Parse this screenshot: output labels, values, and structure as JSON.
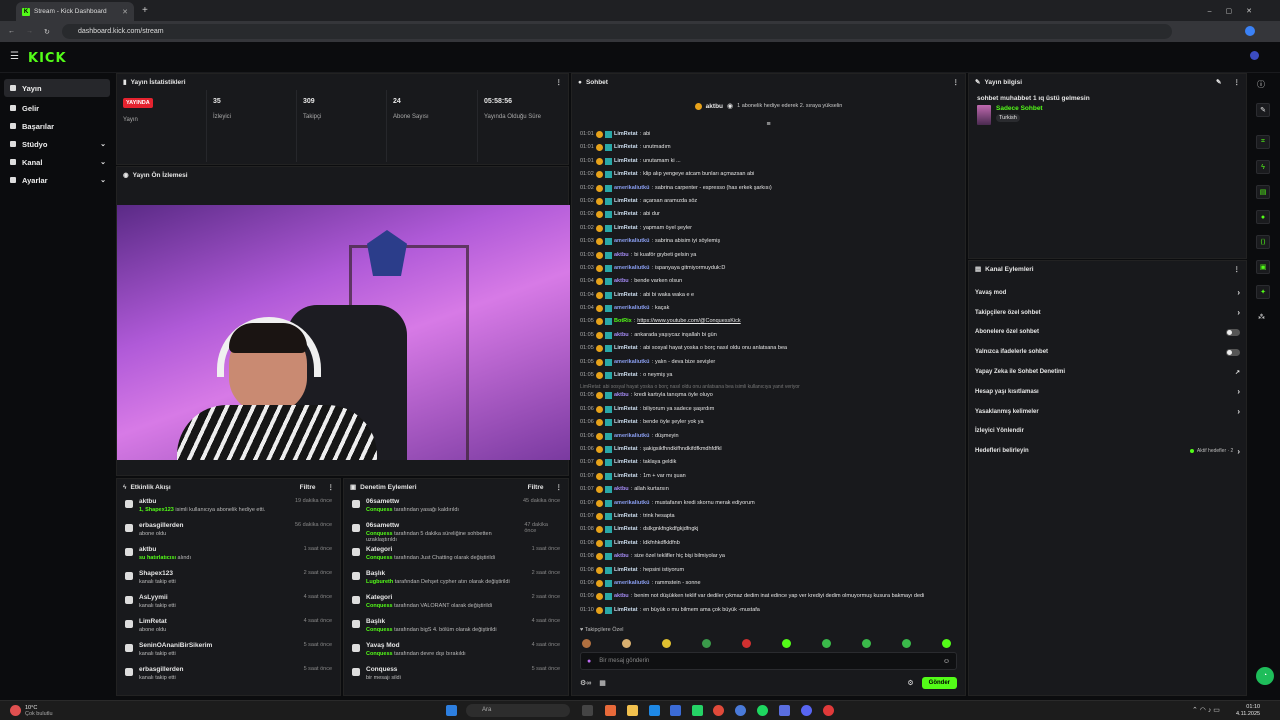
{
  "browser": {
    "tab_title": "Stream - Kick Dashboard",
    "url": "dashboard.kick.com/stream"
  },
  "brand": {
    "logo": "KICK",
    "accent": "#53fc18",
    "live_color": "#e5232f"
  },
  "sidebar": {
    "items": [
      {
        "label": "Yayın",
        "icon": "broadcast-icon"
      },
      {
        "label": "Gelir",
        "icon": "money-icon"
      },
      {
        "label": "Başarılar",
        "icon": "trophy-icon"
      },
      {
        "label": "Stüdyo",
        "icon": "studio-icon"
      },
      {
        "label": "Kanal",
        "icon": "channel-icon"
      },
      {
        "label": "Ayarlar",
        "icon": "settings-icon"
      }
    ]
  },
  "stats": {
    "title": "Yayın İstatistikleri",
    "live_badge": "YAYINDA",
    "live_label": "Yayın",
    "cells": [
      {
        "value": "35",
        "label": "İzleyici"
      },
      {
        "value": "309",
        "label": "Takipçi"
      },
      {
        "value": "24",
        "label": "Abone Sayısı"
      },
      {
        "value": "05:58:56",
        "label": "Yayında Olduğu Süre"
      }
    ]
  },
  "preview": {
    "title": "Yayın Ön İzlemesi"
  },
  "activity": {
    "title": "Etkinlik Akışı",
    "filter": "Filtre",
    "items": [
      {
        "name": "aktbu",
        "sub_hl": "1, Shapex123",
        "sub": " isimli kullanıcıya abonelik hediye etti.",
        "time": "19 dakika önce"
      },
      {
        "name": "erbasgillerden",
        "sub_hl": "",
        "sub": "abone oldu",
        "time": "56 dakika önce"
      },
      {
        "name": "aktbu",
        "sub_hl": "su hatırlatıcısı",
        "sub": " alındı",
        "time": "1 saat önce"
      },
      {
        "name": "Shapex123",
        "sub_hl": "",
        "sub": "kanalı takip etti",
        "time": "2 saat önce"
      },
      {
        "name": "AsLyymii",
        "sub_hl": "",
        "sub": "kanalı takip etti",
        "time": "4 saat önce"
      },
      {
        "name": "LimRetat",
        "sub_hl": "",
        "sub": "abone oldu",
        "time": "4 saat önce"
      },
      {
        "name": "SeninOAnaniBirSikerim",
        "sub_hl": "",
        "sub": "kanalı takip etti",
        "time": "5 saat önce"
      },
      {
        "name": "erbasgillerden",
        "sub_hl": "",
        "sub": "kanalı takip etti",
        "time": "5 saat önce"
      }
    ]
  },
  "moderation": {
    "title": "Denetim Eylemleri",
    "filter": "Filtre",
    "items": [
      {
        "name": "06samettw",
        "sub_hl": "Conquess",
        "sub": " tarafından yasağı kaldırıldı",
        "time": "45 dakika önce"
      },
      {
        "name": "06samettw",
        "sub_hl": "Conquess",
        "sub": " tarafından 5 dakika süreliğine sohbetten uzaklaştırıldı",
        "time": "47 dakika önce"
      },
      {
        "name": "Kategori",
        "sub_hl": "Conquess",
        "sub": " tarafından Just Chatting olarak değiştirildi",
        "time": "1 saat önce"
      },
      {
        "name": "Başlık",
        "sub_hl": "Lugbureth",
        "sub": " tarafından Dehşet cypher atın olarak değiştirildi",
        "time": "2 saat önce"
      },
      {
        "name": "Kategori",
        "sub_hl": "Conquess",
        "sub": " tarafından VALORANT olarak değiştirildi",
        "time": "2 saat önce"
      },
      {
        "name": "Başlık",
        "sub_hl": "Conquess",
        "sub": " tarafından bigS 4. bölüm olarak değiştirildi",
        "time": "4 saat önce"
      },
      {
        "name": "Yavaş Mod",
        "sub_hl": "Conquess",
        "sub": " tarafından devre dışı bırakıldı",
        "time": "4 saat önce"
      },
      {
        "name": "Conquess",
        "sub_hl": "",
        "sub": "bir mesajı sildi",
        "time": "5 saat önce"
      }
    ]
  },
  "chat": {
    "title": "Sohbet",
    "pinned_user": "aktbu",
    "pinned_text": "1 abonelik hediye ederek 2. sıraya yükselin",
    "messages": [
      {
        "t": "01:01",
        "u": "LimRetat",
        "c": "#cde",
        "m": "abi"
      },
      {
        "t": "01:01",
        "u": "LimRetat",
        "c": "#cde",
        "m": "unutmadım"
      },
      {
        "t": "01:01",
        "u": "LimRetat",
        "c": "#cde",
        "m": "unutamam ki ..."
      },
      {
        "t": "01:02",
        "u": "LimRetat",
        "c": "#cde",
        "m": "klip alıp yengeye atcam bunları açmazsan abi"
      },
      {
        "t": "01:02",
        "u": "amerikaliutkü",
        "c": "#8a9ef0",
        "m": "sabrina carpenter - espresso (has erkek şarkısı)"
      },
      {
        "t": "01:02",
        "u": "LimRetat",
        "c": "#cde",
        "m": "açarsan aramızda söz"
      },
      {
        "t": "01:02",
        "u": "LimRetat",
        "c": "#cde",
        "m": "abi dur"
      },
      {
        "t": "01:02",
        "u": "LimRetat",
        "c": "#cde",
        "m": "yapmam öyel şeyler"
      },
      {
        "t": "01:03",
        "u": "amerikaliutkü",
        "c": "#8a9ef0",
        "m": "sabrina abisim iyi söylemiş"
      },
      {
        "t": "01:03",
        "u": "aktbu",
        "c": "#a58bf5",
        "m": "bi kuaför gıybeti gelsin ya"
      },
      {
        "t": "01:03",
        "u": "amerikaliutkü",
        "c": "#8a9ef0",
        "m": "ispanyaya gitmiyormuyduk:D"
      },
      {
        "t": "01:04",
        "u": "aktbu",
        "c": "#a58bf5",
        "m": "bende varken olsun"
      },
      {
        "t": "01:04",
        "u": "LimRetat",
        "c": "#cde",
        "m": "abi bi waka waka e e"
      },
      {
        "t": "01:04",
        "u": "amerikaliutkü",
        "c": "#8a9ef0",
        "m": "kaçak"
      },
      {
        "t": "01:05",
        "u": "BotRix",
        "c": "#53fc18",
        "m": "https://www.youtube.com/@ConquessKick"
      },
      {
        "t": "01:05",
        "u": "aktbu",
        "c": "#a58bf5",
        "m": "ankarada yaşıycaz inşallah bi gün"
      },
      {
        "t": "01:05",
        "u": "LimRetat",
        "c": "#cde",
        "m": "abi sosyal hayat yoska o borç nasıl oldu onu anlatsana bea"
      },
      {
        "t": "01:05",
        "u": "amerikaliutkü",
        "c": "#8a9ef0",
        "m": "yalın - deva bize sevişler"
      },
      {
        "t": "01:05",
        "u": "LimRetat",
        "c": "#cde",
        "m": "o neymiş ya"
      },
      {
        "t": "01:05",
        "u": "aktbu",
        "c": "#a58bf5",
        "m": "kredi kartıyla tanışma öyle oluyo"
      },
      {
        "t": "01:06",
        "u": "LimRetat",
        "c": "#cde",
        "m": "biliyorum ya sadece şaşırdım"
      },
      {
        "t": "01:06",
        "u": "LimRetat",
        "c": "#cde",
        "m": "bende öyle şeyler yok ya"
      },
      {
        "t": "01:06",
        "u": "amerikaliutkü",
        "c": "#8a9ef0",
        "m": "düşmeyin"
      },
      {
        "t": "01:06",
        "u": "LimRetat",
        "c": "#cde",
        "m": "şakigsikfhndkifhndkifdfkmdhfdfkl"
      },
      {
        "t": "01:07",
        "u": "LimRetat",
        "c": "#cde",
        "m": "taklaya geldik"
      },
      {
        "t": "01:07",
        "u": "LimRetat",
        "c": "#cde",
        "m": "1m + var mı şuan"
      },
      {
        "t": "01:07",
        "u": "aktbu",
        "c": "#a58bf5",
        "m": "allah kurtarsın"
      },
      {
        "t": "01:07",
        "u": "amerikaliutkü",
        "c": "#8a9ef0",
        "m": "mustafanın kredi skornu merak ediyorum"
      },
      {
        "t": "01:07",
        "u": "LimRetat",
        "c": "#cde",
        "m": "trink hesapta"
      },
      {
        "t": "01:08",
        "u": "LimRetat",
        "c": "#cde",
        "m": "dslkgnkfngkdfgkjdfngkj"
      },
      {
        "t": "01:08",
        "u": "LimRetat",
        "c": "#cde",
        "m": "ldkfnhkdfkldfnb"
      },
      {
        "t": "01:08",
        "u": "aktbu",
        "c": "#a58bf5",
        "m": "size özel teklifler hiç bişi bilmiyolar ya"
      },
      {
        "t": "01:08",
        "u": "LimRetat",
        "c": "#cde",
        "m": "hepsini istiyorum"
      },
      {
        "t": "01:09",
        "u": "amerikaliutkü",
        "c": "#8a9ef0",
        "m": "rammstein - sonne"
      },
      {
        "t": "01:09",
        "u": "aktbu",
        "c": "#a58bf5",
        "m": "benim not düşükken teklif var dediler çıkmaz dedim inat edince yap ver krediyi dedim olmuyormuş kusura bakmayı dedi"
      },
      {
        "t": "01:10",
        "u": "LimRetat",
        "c": "#cde",
        "m": "en büyük o mu bilmem ama çok büyük -mustafa"
      }
    ],
    "deleted_note": "LimRetat: abi sosyal hayat yoska o borç nasıl oldu onu anlatsana bea isimli kullanıcıya yanıt veriyor",
    "followers_only": "Takipçilere Özel",
    "input_placeholder": "Bir mesaj gönderin",
    "send_label": "Gönder"
  },
  "stream_info": {
    "title": "Yayın bilgisi",
    "stream_title": "sohbet muhabbet 1 ıq üstü gelmesin",
    "category": "Sadece Sohbet",
    "tag": "Turkish"
  },
  "channel_actions": {
    "title": "Kanal Eylemleri",
    "rows": [
      {
        "label": "Yavaş mod",
        "kind": "chev"
      },
      {
        "label": "Takipçilere özel sohbet",
        "kind": "chev"
      },
      {
        "label": "Abonelere özel sohbet",
        "kind": "toggle"
      },
      {
        "label": "Yalnızca ifadelerle sohbet",
        "kind": "toggle"
      },
      {
        "label": "Yapay Zeka ile Sohbet Denetimi",
        "kind": "ext"
      },
      {
        "label": "Hesap yaşı kısıtlaması",
        "kind": "chev"
      },
      {
        "label": "Yasaklanmış kelimeler",
        "kind": "chev"
      },
      {
        "label": "İzleyici Yönlendir",
        "kind": "none"
      },
      {
        "label": "Hedefleri belirleyin",
        "kind": "goal"
      }
    ],
    "goal_text": "Aktif hedefler · 2"
  },
  "taskbar": {
    "weather_temp": "10°C",
    "weather_desc": "Çok bulutlu",
    "search_placeholder": "Ara",
    "time": "01:10",
    "date": "4.11.2025"
  }
}
